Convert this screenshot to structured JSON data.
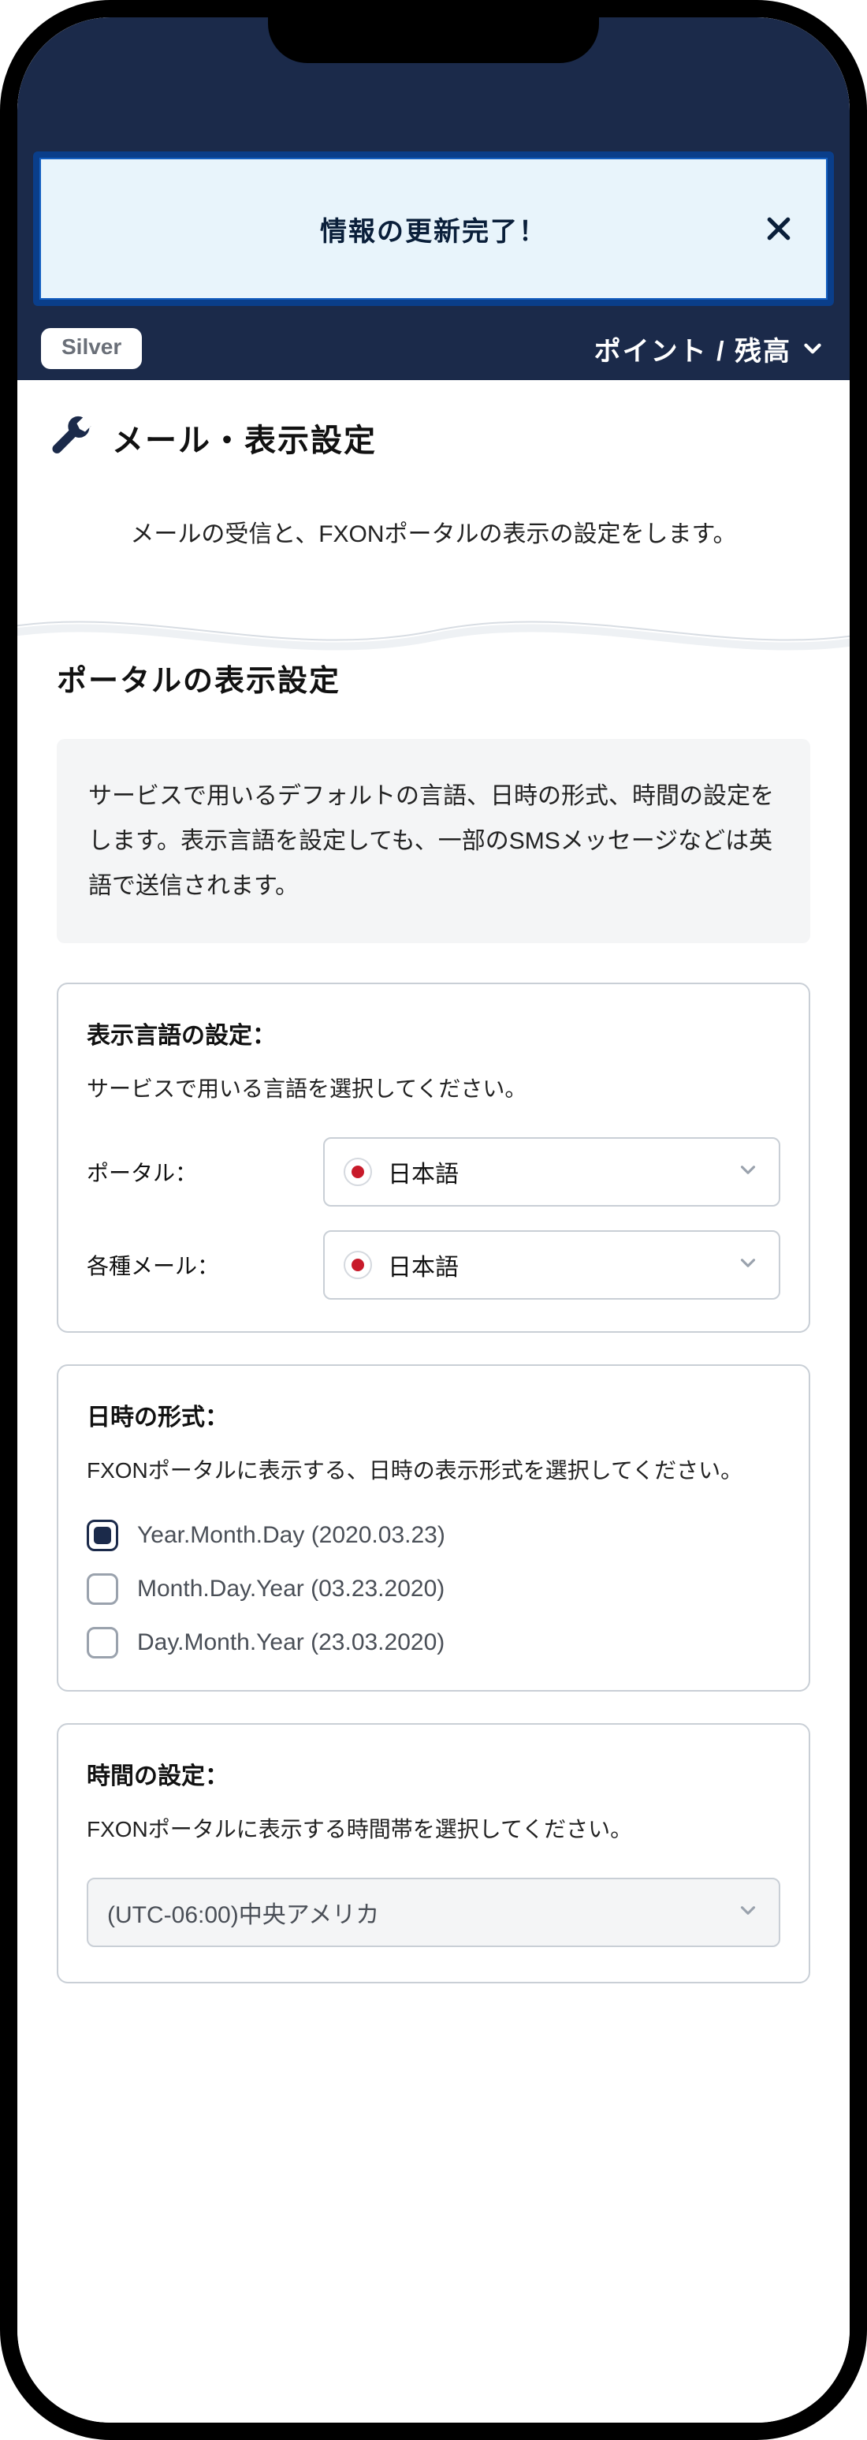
{
  "toast": {
    "message": "情報の更新完了！"
  },
  "header": {
    "tier": "Silver",
    "points_label": "ポイント / 残高"
  },
  "section": {
    "title": "メール・表示設定",
    "description": "メールの受信と、FXONポータルの表示の設定をします。"
  },
  "portal_display": {
    "heading": "ポータルの表示設定",
    "info": "サービスで用いるデフォルトの言語、日時の形式、時間の設定をします。表示言語を設定しても、一部のSMSメッセージなどは英語で送信されます。",
    "language": {
      "title": "表示言語の設定：",
      "hint": "サービスで用いる言語を選択してください。",
      "portal_label": "ポータル：",
      "portal_value": "日本語",
      "mail_label": "各種メール：",
      "mail_value": "日本語"
    },
    "date_format": {
      "title": "日時の形式：",
      "hint": "FXONポータルに表示する、日時の表示形式を選択してください。",
      "options": [
        {
          "label": "Year.Month.Day (2020.03.23)",
          "selected": true
        },
        {
          "label": "Month.Day.Year (03.23.2020)",
          "selected": false
        },
        {
          "label": "Day.Month.Year (23.03.2020)",
          "selected": false
        }
      ]
    },
    "timezone": {
      "title": "時間の設定：",
      "hint": "FXONポータルに表示する時間帯を選択してください。",
      "value": "(UTC-06:00)中央アメリカ"
    }
  }
}
